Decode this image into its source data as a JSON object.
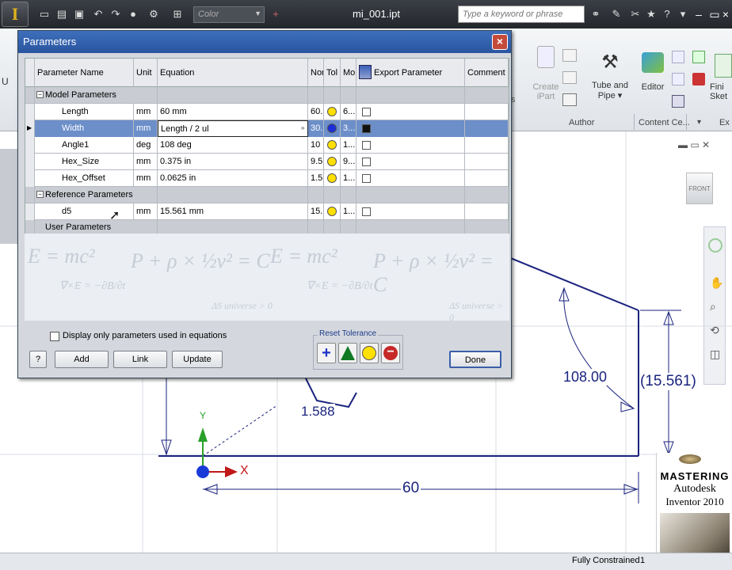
{
  "window": {
    "document_title": "mi_001.ipt",
    "search_placeholder": "Type a keyword or phrase",
    "color_value": "Color"
  },
  "ribbon": {
    "buttons": [
      {
        "label_line1": "Create",
        "label_line2": "iPart",
        "icon": "create-ipart-icon"
      },
      {
        "label_line1": "Tube and",
        "label_line2": "Pipe",
        "icon": "tube-pipe-icon"
      },
      {
        "label_line1": "Editor",
        "label_line2": "",
        "icon": "editor-icon"
      },
      {
        "label_line1": "Fini",
        "label_line2": "Sket",
        "icon": "finish-sketch-icon"
      }
    ],
    "groups": [
      "Author",
      "Content Ce...",
      "Ex"
    ],
    "left_fragment": "U",
    "left_fragment2": "ts"
  },
  "dialog": {
    "title": "Parameters",
    "columns": [
      "Parameter Name",
      "Unit",
      "Equation",
      "Nor",
      "Tol",
      "Mo",
      "Export Parameter",
      "Comment"
    ],
    "groups": {
      "model": "Model Parameters",
      "reference": "Reference Parameters",
      "user": "User Parameters"
    },
    "rows": [
      {
        "name": "Length",
        "unit": "mm",
        "equation": "60 mm",
        "nominal": "60.",
        "model": "6...",
        "tol_color": "yellow"
      },
      {
        "name": "Width",
        "unit": "mm",
        "equation": "Length / 2 ul",
        "nominal": "30.",
        "model": "3...",
        "tol_color": "blue",
        "selected": true
      },
      {
        "name": "Angle1",
        "unit": "deg",
        "equation": "108 deg",
        "nominal": "10",
        "model": "1...",
        "tol_color": "yellow"
      },
      {
        "name": "Hex_Size",
        "unit": "mm",
        "equation": "0.375 in",
        "nominal": "9.5",
        "model": "9...",
        "tol_color": "yellow"
      },
      {
        "name": "Hex_Offset",
        "unit": "mm",
        "equation": "0.0625 in",
        "nominal": "1.5",
        "model": "1...",
        "tol_color": "yellow"
      }
    ],
    "ref_rows": [
      {
        "name": "d5",
        "unit": "mm",
        "equation": "15.561 mm",
        "nominal": "15.",
        "model": "1...",
        "tol_color": "yellow"
      }
    ],
    "background_formulas": [
      "E = mc²",
      "P + ρ × ½v² = C",
      "∇×E = −∂B/∂t",
      "ΔS universe > 0"
    ],
    "display_only_label": "Display only parameters used in equations",
    "reset_tolerance_label": "Reset Tolerance",
    "buttons": {
      "add": "Add",
      "link": "Link",
      "update": "Update",
      "done": "Done",
      "help": "?"
    }
  },
  "sketch": {
    "dims": [
      "108.00",
      "(15.561)",
      "1.588",
      "60"
    ],
    "axis_x": "X",
    "axis_y": "Y",
    "view_cube": "FRONT"
  },
  "book": {
    "line1": "MASTERING",
    "line2": "Autodesk",
    "line3": "Inventor 2010"
  },
  "status": {
    "text": "Fully Constrained",
    "count": "1"
  },
  "colors": {
    "title_bar": "#2b2f35",
    "dialog_title": "#2f5ea8",
    "selection": "#6c8fc9",
    "sketch_line": "#1a237e",
    "tol_yellow": "#ffe000"
  }
}
